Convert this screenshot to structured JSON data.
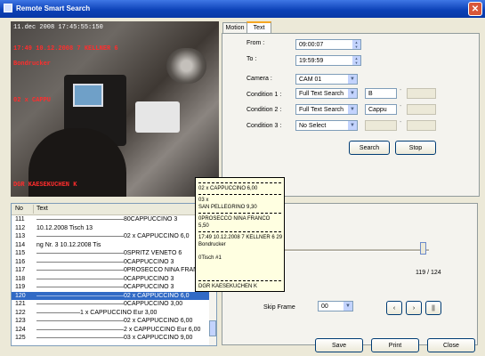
{
  "window": {
    "title": "Remote Smart Search",
    "close_glyph": "✕"
  },
  "video": {
    "timestamp": "11.dec 2008 17:45:55:150",
    "overlay_line1": "17:49 10.12.2008 7 KELLNER 6",
    "overlay_line2": "Bondrucker",
    "overlay_line3": "02 x CAPPU",
    "overlay_line4": "DGR KAESEKUCHEN K"
  },
  "tabs": [
    {
      "label": "Motion"
    },
    {
      "label": "Text"
    }
  ],
  "search": {
    "from_label": "From :",
    "from_value": "09:00:07",
    "to_label": "To :",
    "to_value": "19:59:59",
    "camera_label": "Camera :",
    "camera_value": "CAM 01",
    "condition1_label": "Condition 1 :",
    "condition1_type": "Full Text Search",
    "condition1_value": "B",
    "condition2_label": "Condition 2 :",
    "condition2_type": "Full Text Search",
    "condition2_value": "Cappu",
    "condition3_label": "Condition 3 :",
    "condition3_type": "No Select",
    "search_button": "Search",
    "stop_button": "Stop"
  },
  "list": {
    "col_no": "No",
    "col_text": "Text",
    "rows": [
      {
        "no": "111",
        "text": "——————————————80CAPPUCCINO        3"
      },
      {
        "no": "112",
        "text": "10.12.2008          Tisch 13"
      },
      {
        "no": "113",
        "text": "——————————————02 x CAPPUCCINO     6,0"
      },
      {
        "no": "114",
        "text": "ng Nr. 3          10.12.2008          Tis"
      },
      {
        "no": "115",
        "text": "——————————————0SPRITZ VENETO      6"
      },
      {
        "no": "116",
        "text": "——————————————0CAPPUCCINO         3"
      },
      {
        "no": "117",
        "text": "——————————————0PROSECCO NINA FRAN"
      },
      {
        "no": "118",
        "text": "——————————————0CAPPUCCINO         3"
      },
      {
        "no": "119",
        "text": "——————————————0CAPPUCCINO         3"
      },
      {
        "no": "120",
        "text": "——————————————02 x CAPPUCCINO     6,0"
      },
      {
        "no": "121",
        "text": "——————————————0CAPPUCCINO         3,00"
      },
      {
        "no": "122",
        "text": "———————1 x CAPPUCCINO    Eur 3,00"
      },
      {
        "no": "123",
        "text": "——————————————02 x CAPPUCCINO     6,00"
      },
      {
        "no": "124",
        "text": "——————————————2 x CAPPUCCINO   Eur 6,00"
      },
      {
        "no": "125",
        "text": "——————————————03 x CAPPUCCINO     9,00"
      }
    ],
    "selected_index": 9
  },
  "tooltip": {
    "line1": "02 x CAPPUCCINO          6,00",
    "line2": "03 x",
    "line3": "SAN PELLEGRINO          9,30",
    "line4": "0PROSECCO NINA FRANCO",
    "line5": "                         5,50",
    "line6": "17:49 10.12.2008 7 KELLNER 6       29",
    "line7": "Bondrucker",
    "line8": "0Tisch #1",
    "line9": "DGR KAESEKUCHEN K"
  },
  "playback": {
    "position_text": "119 / 124",
    "position_fraction": 0.96,
    "skip_frame_label": "Skip Frame",
    "skip_frame_value": "00",
    "prev_glyph": "‹",
    "next_glyph": "›",
    "pause_glyph": "||"
  },
  "footer": {
    "save_button": "Save",
    "print_button": "Print",
    "close_button": "Close"
  }
}
